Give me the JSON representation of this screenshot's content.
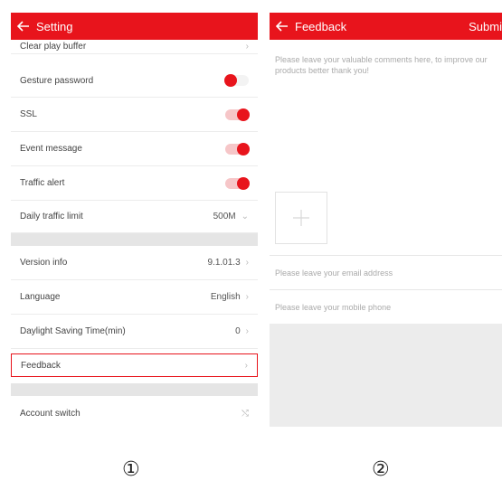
{
  "setting": {
    "title": "Setting",
    "rows": {
      "clear_play_buffer": "Clear play buffer",
      "gesture_password": "Gesture password",
      "ssl": "SSL",
      "event_message": "Event message",
      "traffic_alert": "Traffic alert",
      "daily_traffic_limit": "Daily traffic limit",
      "daily_traffic_limit_value": "500M",
      "version_info": "Version info",
      "version_info_value": "9.1.01.3",
      "language": "Language",
      "language_value": "English",
      "daylight_saving": "Daylight Saving Time(min)",
      "daylight_saving_value": "0",
      "feedback": "Feedback",
      "account_switch": "Account switch"
    },
    "toggles": {
      "gesture_password": false,
      "ssl": true,
      "event_message": true,
      "traffic_alert": true
    }
  },
  "feedback": {
    "title": "Feedback",
    "submit_label": "Submi",
    "comment_placeholder": "Please leave your valuable comments here, to improve our products better thank you!",
    "email_placeholder": "Please leave your email address",
    "phone_placeholder": "Please leave your mobile phone"
  },
  "labels": {
    "step1": "①",
    "step2": "②"
  },
  "colors": {
    "accent": "#e8141c"
  }
}
